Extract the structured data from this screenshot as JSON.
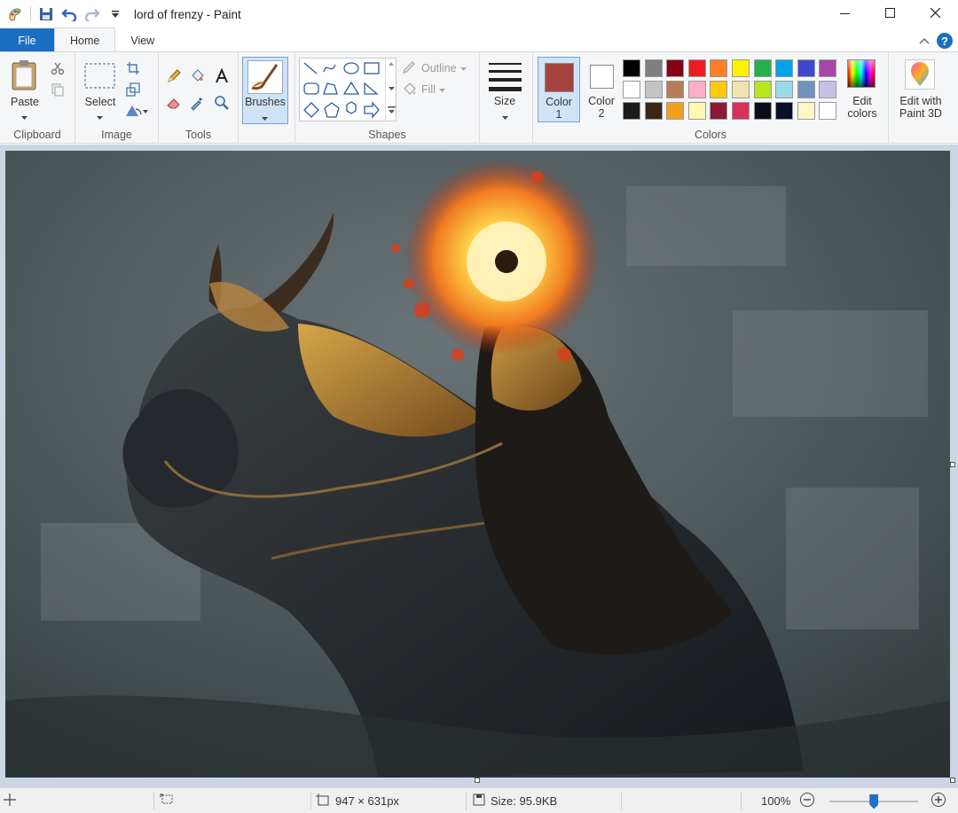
{
  "window": {
    "title": "lord of frenzy - Paint",
    "minimize": "—",
    "maximize": "☐",
    "close": "✕"
  },
  "tabs": {
    "file": "File",
    "home": "Home",
    "view": "View",
    "help": "?"
  },
  "ribbon": {
    "clipboard": {
      "group_label": "Clipboard",
      "paste": "Paste"
    },
    "image": {
      "group_label": "Image",
      "select": "Select"
    },
    "tools": {
      "group_label": "Tools"
    },
    "brushes": {
      "label": "Brushes"
    },
    "shapes": {
      "group_label": "Shapes",
      "outline": "Outline",
      "fill": "Fill"
    },
    "size": {
      "label": "Size"
    },
    "colors": {
      "group_label": "Colors",
      "color1_label": "Color",
      "color1_num": "1",
      "color2_label": "Color",
      "color2_num": "2",
      "color1_value": "#a5433e",
      "color2_value": "#ffffff",
      "edit_colors_line1": "Edit",
      "edit_colors_line2": "colors",
      "paint3d_line1": "Edit with",
      "paint3d_line2": "Paint 3D",
      "palette": [
        [
          "#000000",
          "#7f7f7f",
          "#880015",
          "#ed1c24",
          "#ff7f27",
          "#fff200",
          "#22b14c",
          "#00a2e8",
          "#3f48cc",
          "#a349a4"
        ],
        [
          "#ffffff",
          "#c3c3c3",
          "#b97a57",
          "#ffaec9",
          "#ffc90e",
          "#efe4b0",
          "#b5e61d",
          "#99d9ea",
          "#7092be",
          "#c8bfe7"
        ],
        [
          "#1a1a1a",
          "#3a2615",
          "#f0a020",
          "#fff8b0",
          "#8b1a3a",
          "#d8315b",
          "#0c0c1a",
          "#0a0f28",
          "#fff6c8",
          "#ffffff"
        ]
      ]
    }
  },
  "status": {
    "dimensions": "947 × 631px",
    "filesize": "Size: 95.9KB",
    "zoom": "100%",
    "zoom_level_fraction": 0.5
  }
}
